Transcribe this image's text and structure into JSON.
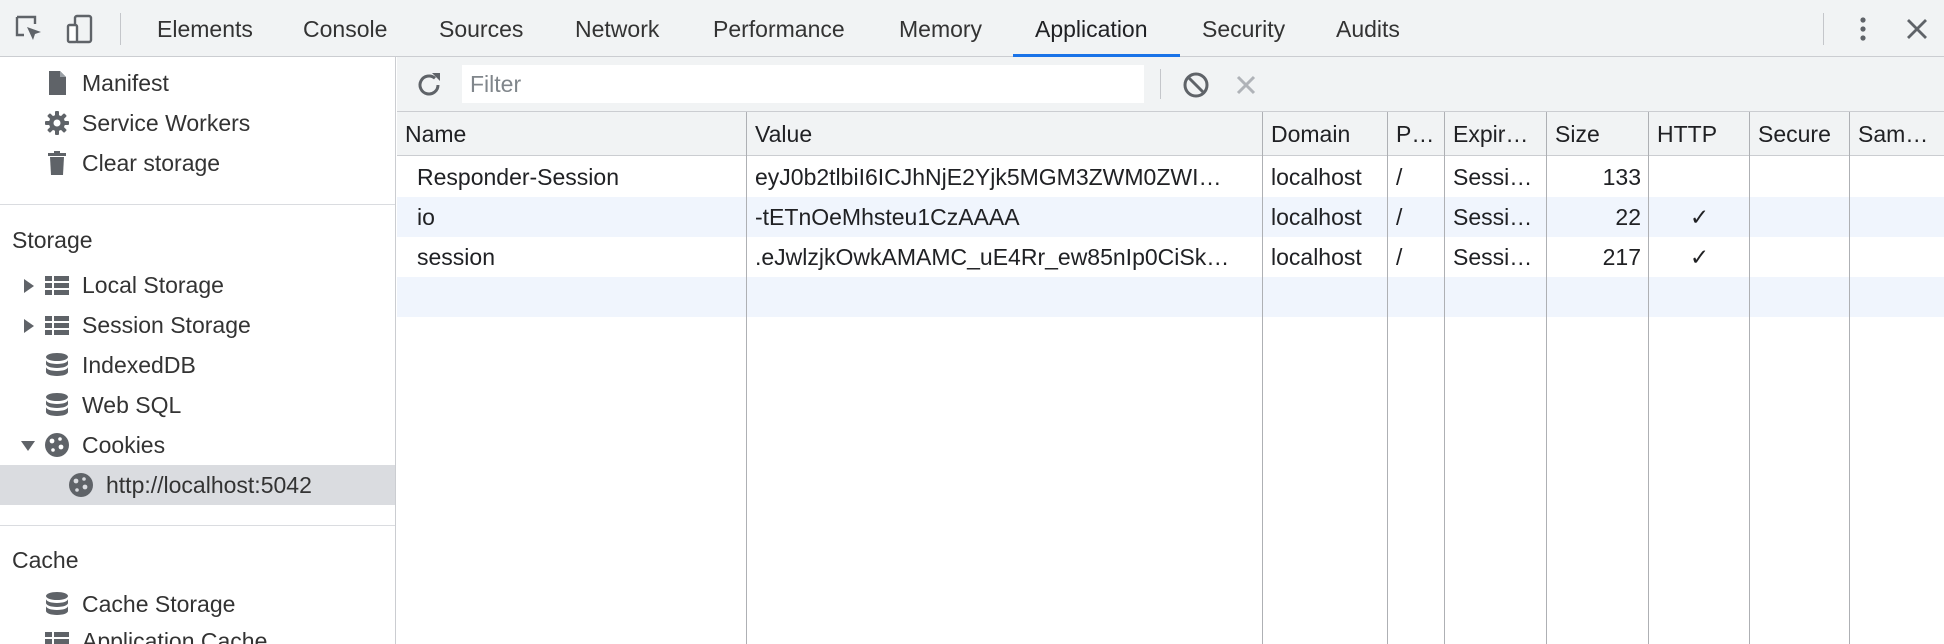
{
  "devtools": {
    "tabs": [
      {
        "label": "Elements"
      },
      {
        "label": "Console"
      },
      {
        "label": "Sources"
      },
      {
        "label": "Network"
      },
      {
        "label": "Performance"
      },
      {
        "label": "Memory"
      },
      {
        "label": "Application",
        "active": true
      },
      {
        "label": "Security"
      },
      {
        "label": "Audits"
      }
    ],
    "accent_color": "#1a73e8"
  },
  "sidebar": {
    "app_items": [
      {
        "label": "Manifest",
        "icon": "document-icon"
      },
      {
        "label": "Service Workers",
        "icon": "gear-icon"
      },
      {
        "label": "Clear storage",
        "icon": "trash-icon"
      }
    ],
    "storage_heading": "Storage",
    "storage_items": [
      {
        "label": "Local Storage",
        "icon": "grid-icon",
        "expander": "collapsed"
      },
      {
        "label": "Session Storage",
        "icon": "grid-icon",
        "expander": "collapsed"
      },
      {
        "label": "IndexedDB",
        "icon": "database-icon"
      },
      {
        "label": "Web SQL",
        "icon": "database-icon"
      },
      {
        "label": "Cookies",
        "icon": "cookie-icon",
        "expander": "expanded"
      },
      {
        "label": "http://localhost:5042",
        "icon": "cookie-icon",
        "selected": true
      }
    ],
    "cache_heading": "Cache",
    "cache_items": [
      {
        "label": "Cache Storage",
        "icon": "database-icon"
      },
      {
        "label": "Application Cache",
        "icon": "grid-icon"
      }
    ]
  },
  "toolbar": {
    "filter_placeholder": "Filter",
    "refresh_icon": "refresh-icon",
    "clear_all_icon": "block-icon",
    "delete_icon": "close-icon"
  },
  "cookies": {
    "columns": [
      "Name",
      "Value",
      "Domain",
      "P…",
      "Expir…",
      "Size",
      "HTTP",
      "Secure",
      "Sam…"
    ],
    "rows": [
      {
        "name": "Responder-Session",
        "value": "eyJ0b2tlbiI6ICJhNjE2Yjk5MGM3ZWM0ZWI…",
        "domain": "localhost",
        "path": "/",
        "expires": "Sessi…",
        "size": "133",
        "http": ""
      },
      {
        "name": "io",
        "value": "-tETnOeMhsteu1CzAAAA",
        "domain": "localhost",
        "path": "/",
        "expires": "Sessi…",
        "size": "22",
        "http": "✓"
      },
      {
        "name": "session",
        "value": ".eJwlzjkOwkAMAMC_uE4Rr_ew85nIp0CiSk…",
        "domain": "localhost",
        "path": "/",
        "expires": "Sessi…",
        "size": "217",
        "http": "✓"
      }
    ]
  }
}
